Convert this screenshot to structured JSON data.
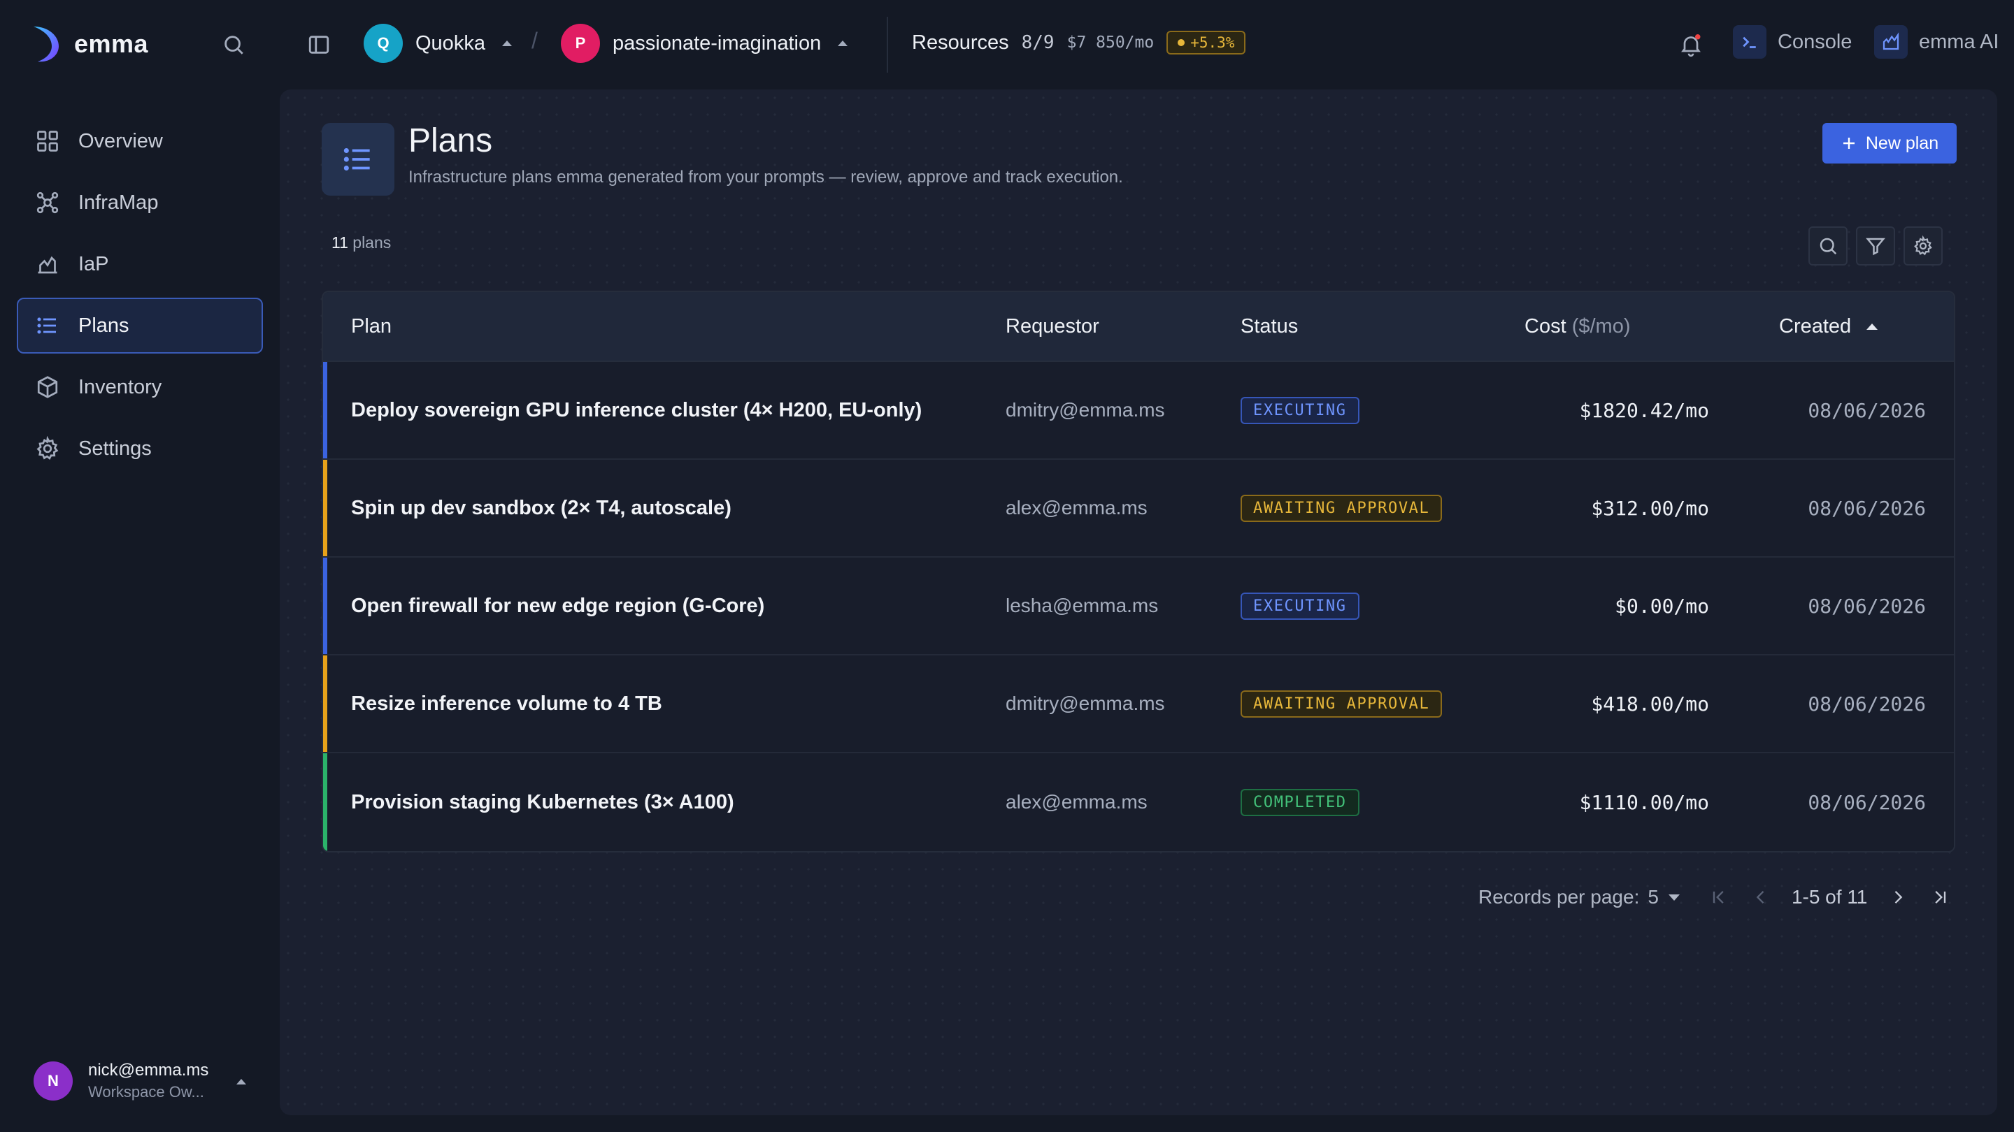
{
  "app": {
    "name": "emma"
  },
  "topbar": {
    "workspace": {
      "initial": "Q",
      "name": "Quokka",
      "color": "#16a3c7"
    },
    "project": {
      "initial": "P",
      "name": "passionate-imagination",
      "color": "#e11d63"
    },
    "separator": "/",
    "resources": {
      "label": "Resources",
      "count": "8/9",
      "cost": "$7 850/mo",
      "delta": "+5.3%"
    },
    "console_label": "Console",
    "ai_label": "emma AI"
  },
  "sidebar": {
    "items": [
      {
        "label": "Overview",
        "icon": "grid-icon"
      },
      {
        "label": "InfraMap",
        "icon": "network-icon"
      },
      {
        "label": "IaP",
        "icon": "chart-hand-icon"
      },
      {
        "label": "Plans",
        "icon": "list-icon",
        "active": true
      },
      {
        "label": "Inventory",
        "icon": "cube-icon"
      },
      {
        "label": "Settings",
        "icon": "gear-icon"
      }
    ],
    "user": {
      "initial": "N",
      "email": "nick@emma.ms",
      "role": "Workspace Ow..."
    }
  },
  "page": {
    "title": "Plans",
    "subtitle": "Infrastructure plans emma generated from your prompts — review, approve and track execution.",
    "new_button": "New plan",
    "count_number": "11",
    "count_label": "plans"
  },
  "table": {
    "columns": {
      "plan": "Plan",
      "requestor": "Requestor",
      "status": "Status",
      "cost": "Cost",
      "cost_unit": "($/mo)",
      "created": "Created"
    },
    "rows": [
      {
        "plan": "Deploy sovereign GPU inference cluster (4× H200, EU-only)",
        "requestor": "dmitry@emma.ms",
        "status": "EXECUTING",
        "cost": "$1820.42/mo",
        "created": "08/06/2026",
        "accent": "#3b63e0"
      },
      {
        "plan": "Spin up dev sandbox (2× T4, autoscale)",
        "requestor": "alex@emma.ms",
        "status": "AWAITING APPROVAL",
        "cost": "$312.00/mo",
        "created": "08/06/2026",
        "accent": "#e7a21a"
      },
      {
        "plan": "Open firewall for new edge region (G-Core)",
        "requestor": "lesha@emma.ms",
        "status": "EXECUTING",
        "cost": "$0.00/mo",
        "created": "08/06/2026",
        "accent": "#3b63e0"
      },
      {
        "plan": "Resize inference volume to 4 TB",
        "requestor": "dmitry@emma.ms",
        "status": "AWAITING APPROVAL",
        "cost": "$418.00/mo",
        "created": "08/06/2026",
        "accent": "#e7a21a"
      },
      {
        "plan": "Provision staging Kubernetes (3× A100)",
        "requestor": "alex@emma.ms",
        "status": "COMPLETED",
        "cost": "$1110.00/mo",
        "created": "08/06/2026",
        "accent": "#2bb36a"
      }
    ]
  },
  "pagination": {
    "label": "Records per page:",
    "per_page": "5",
    "range": "1-5 of 11"
  }
}
